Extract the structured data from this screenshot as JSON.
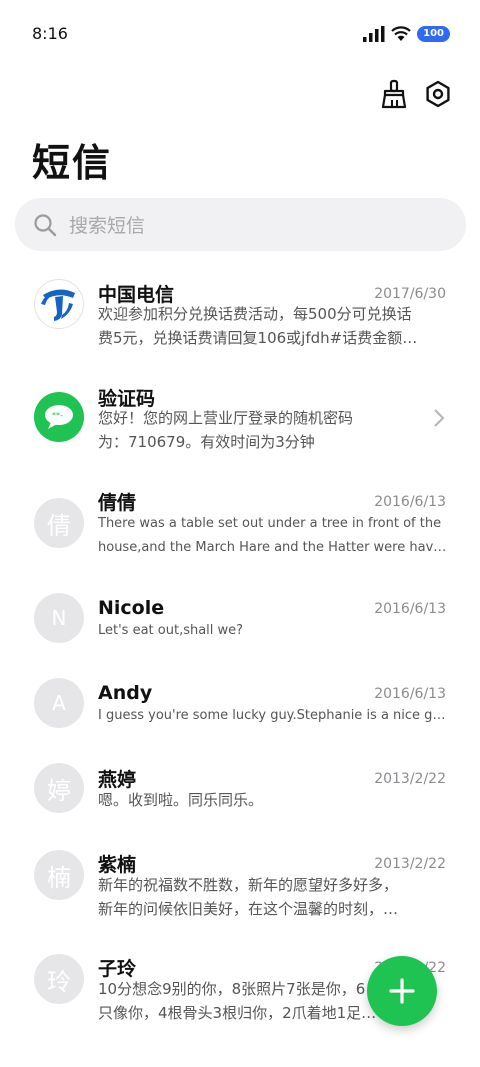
{
  "status_bar": {
    "time": "8:16",
    "battery": "100"
  },
  "toolbar": {
    "clean_icon": "broom-icon",
    "settings_icon": "gear-icon"
  },
  "page_title": "短信",
  "search": {
    "placeholder": "搜索短信"
  },
  "conversations": [
    {
      "name": "中国电信",
      "date": "2017/6/30",
      "avatar": "china-telecom-logo",
      "preview_lines": [
        "欢迎参加积分兑换话费活动，每500分可兑换话",
        "费5元，兑换话费请回复106或jfdh#话费金额…"
      ]
    },
    {
      "name": "验证码",
      "date": "",
      "avatar": "sms-bubble-icon",
      "preview_lines": [
        "您好！您的网上营业厅登录的随机密码",
        "为：710679。有效时间为3分钟"
      ]
    },
    {
      "name": "倩倩",
      "date": "2016/6/13",
      "avatar": "倩",
      "preview_lines": [
        "There was a table set out under a tree in front of the",
        "house,and the March Hare and the Hatter were havin…"
      ]
    },
    {
      "name": "Nicole",
      "date": "2016/6/13",
      "avatar": "N",
      "preview_lines": [
        "Let's eat out,shall we?"
      ]
    },
    {
      "name": "Andy",
      "date": "2016/6/13",
      "avatar": "A",
      "preview_lines": [
        "I guess you're some lucky guy.Stephanie is a nice girl."
      ]
    },
    {
      "name": "燕婷",
      "date": "2013/2/22",
      "avatar": "婷",
      "preview_lines": [
        "嗯。收到啦。同乐同乐。"
      ]
    },
    {
      "name": "紫楠",
      "date": "2013/2/22",
      "avatar": "楠",
      "preview_lines": [
        "新年的祝福数不胜数，新年的愿望好多好多，",
        "新年的问候依旧美好，在这个温馨的时刻，…"
      ]
    },
    {
      "name": "子玲",
      "date": "2013/2/22",
      "avatar": "玲",
      "preview_lines": [
        "10分想念9别的你，8张照片7张是你，6 5",
        "只像你，4根骨头3根归你，2爪着地1足…"
      ]
    }
  ],
  "fab": {
    "icon": "plus-icon"
  },
  "colors": {
    "accent_green": "#1fc352",
    "telecom_blue": "#1565c0",
    "battery_blue": "#2f6bf2"
  }
}
